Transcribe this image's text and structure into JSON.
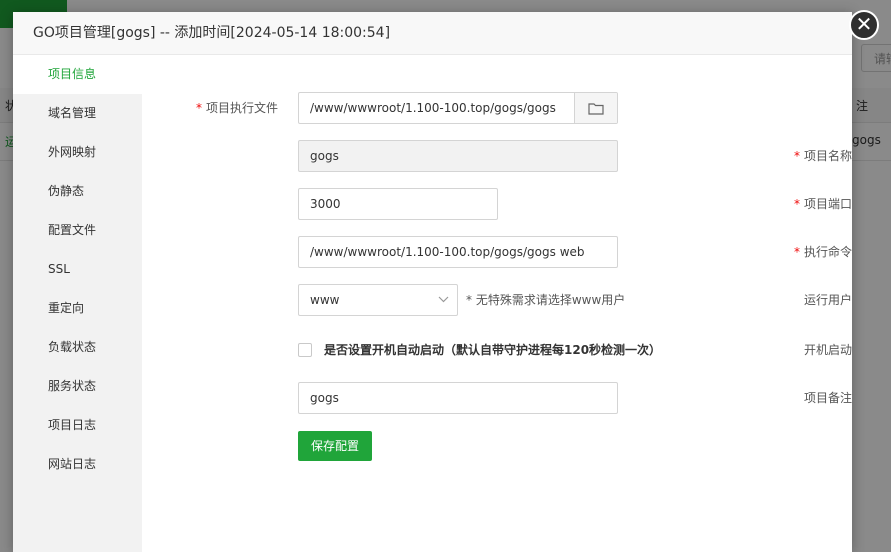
{
  "background": {
    "search_placeholder": "请输",
    "left_header": "状",
    "left_row": "运",
    "right_header": "注",
    "right_row": "gogs"
  },
  "dialog": {
    "title": "GO项目管理[gogs] -- 添加时间[2024-05-14 18:00:54]",
    "close_symbol": "✕"
  },
  "sidebar": {
    "items": [
      {
        "label": "项目信息",
        "active": true
      },
      {
        "label": "域名管理"
      },
      {
        "label": "外网映射"
      },
      {
        "label": "伪静态"
      },
      {
        "label": "配置文件"
      },
      {
        "label": "SSL"
      },
      {
        "label": "重定向"
      },
      {
        "label": "负载状态"
      },
      {
        "label": "服务状态"
      },
      {
        "label": "项目日志"
      },
      {
        "label": "网站日志"
      }
    ]
  },
  "form": {
    "exec_file": {
      "label": "项目执行文件",
      "required": "*",
      "value": "/www/wwwroot/1.100-100.top/gogs/gogs"
    },
    "name": {
      "label": "项目名称",
      "required": "*",
      "value": "gogs"
    },
    "port": {
      "label": "项目端口",
      "required": "*",
      "value": "3000"
    },
    "command": {
      "label": "执行命令",
      "required": "*",
      "value": "/www/wwwroot/1.100-100.top/gogs/gogs web"
    },
    "user": {
      "label": "运行用户",
      "value": "www",
      "hint": "* 无特殊需求请选择www用户"
    },
    "autostart": {
      "label": "开机启动",
      "checkbox_label": "是否设置开机自动启动（默认自带守护进程每120秒检测一次）",
      "checked": false
    },
    "remark": {
      "label": "项目备注",
      "value": "gogs"
    },
    "save_label": "保存配置"
  },
  "colors": {
    "accent": "#20a53a",
    "required": "#ef0808"
  }
}
